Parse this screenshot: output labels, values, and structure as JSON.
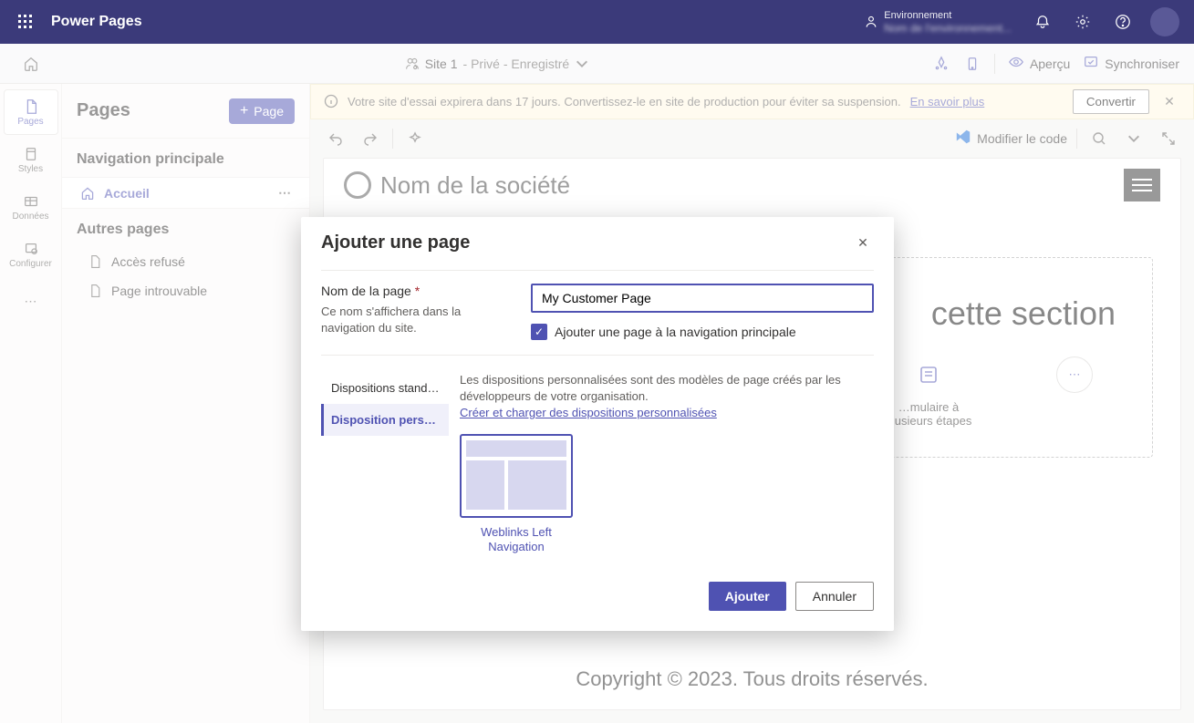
{
  "header": {
    "app_name": "Power Pages",
    "env_label": "Environnement",
    "env_value": "Nom de l'environnement..."
  },
  "command_bar": {
    "site_name": "Site 1",
    "site_suffix": " - Privé - Enregistré",
    "preview": "Aperçu",
    "sync": "Synchroniser"
  },
  "rail": {
    "pages": "Pages",
    "styles": "Styles",
    "data": "Données",
    "configure": "Configurer"
  },
  "left_panel": {
    "title": "Pages",
    "add_page": "Page",
    "nav_main": "Navigation principale",
    "home": "Accueil",
    "other_pages": "Autres pages",
    "denied": "Accès refusé",
    "not_found": "Page introuvable"
  },
  "notice": {
    "text": "Votre site d'essai expirera dans 17 jours. Convertissez-le en site de production pour éviter sa suspension.",
    "link": "En savoir plus",
    "convert": "Convertir"
  },
  "canvas_toolbar": {
    "edit_code": "Modifier le code"
  },
  "preview": {
    "company": "Nom de la société",
    "section_title": "cette section",
    "multi_form": "…mulaire à plusieurs étapes",
    "footer": "Copyright © 2023. Tous droits réservés."
  },
  "modal": {
    "title": "Ajouter une page",
    "name_label": "Nom de la page",
    "name_hint": "Ce nom s'affichera dans la navigation du site.",
    "name_value": "My Customer Page",
    "add_nav": "Ajouter une page à la navigation principale",
    "tab_standard": "Dispositions stand…",
    "tab_custom": "Disposition perso…",
    "layout_desc": "Les dispositions personnalisées sont des modèles de page créés par les développeurs de votre organisation.",
    "layout_link": "Créer et charger des dispositions personnalisées",
    "thumb_label": "Weblinks Left Navigation",
    "add_btn": "Ajouter",
    "cancel_btn": "Annuler"
  }
}
